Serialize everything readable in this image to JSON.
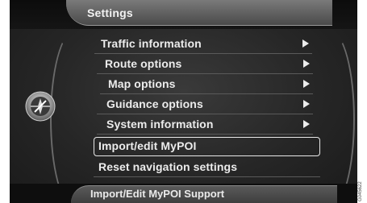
{
  "header": {
    "title": "Settings"
  },
  "menu": {
    "items": [
      {
        "label": "Traffic information",
        "has_submenu": true
      },
      {
        "label": "Route options",
        "has_submenu": true
      },
      {
        "label": "Map options",
        "has_submenu": true
      },
      {
        "label": "Guidance options",
        "has_submenu": true
      },
      {
        "label": "System information",
        "has_submenu": true
      },
      {
        "label": "Import/edit MyPOI",
        "has_submenu": false,
        "selected": true
      },
      {
        "label": "Reset navigation settings",
        "has_submenu": false
      }
    ]
  },
  "footer": {
    "help_text": "Import/Edit MyPOI Support"
  },
  "reference_code": "G045622",
  "icons": {
    "dial": "navigation-dial-icon",
    "arrow": "chevron-right-icon"
  },
  "colors": {
    "background": "#262626",
    "text": "#ececec",
    "selection_border": "#e8e8e8"
  }
}
